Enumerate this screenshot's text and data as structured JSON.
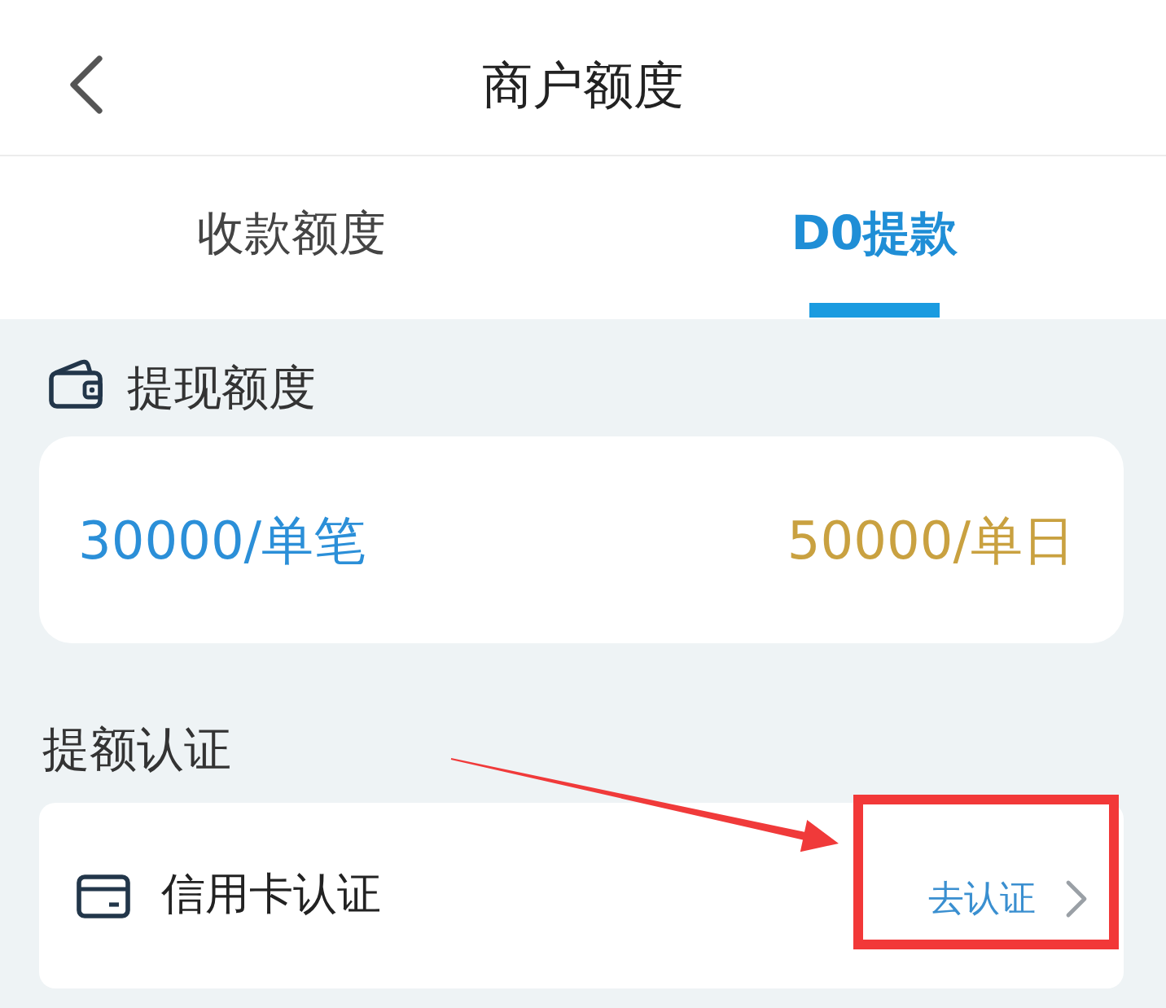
{
  "header": {
    "title": "商户额度"
  },
  "tabs": [
    {
      "label": "收款额度",
      "selected": false
    },
    {
      "label": "D0提款",
      "selected": true
    }
  ],
  "withdraw_limit": {
    "title": "提现额度",
    "per_transaction": "30000/单笔",
    "per_day": "50000/单日"
  },
  "limit_increase": {
    "title": "提额认证",
    "items": [
      {
        "label": "信用卡认证",
        "action": "去认证"
      }
    ]
  }
}
